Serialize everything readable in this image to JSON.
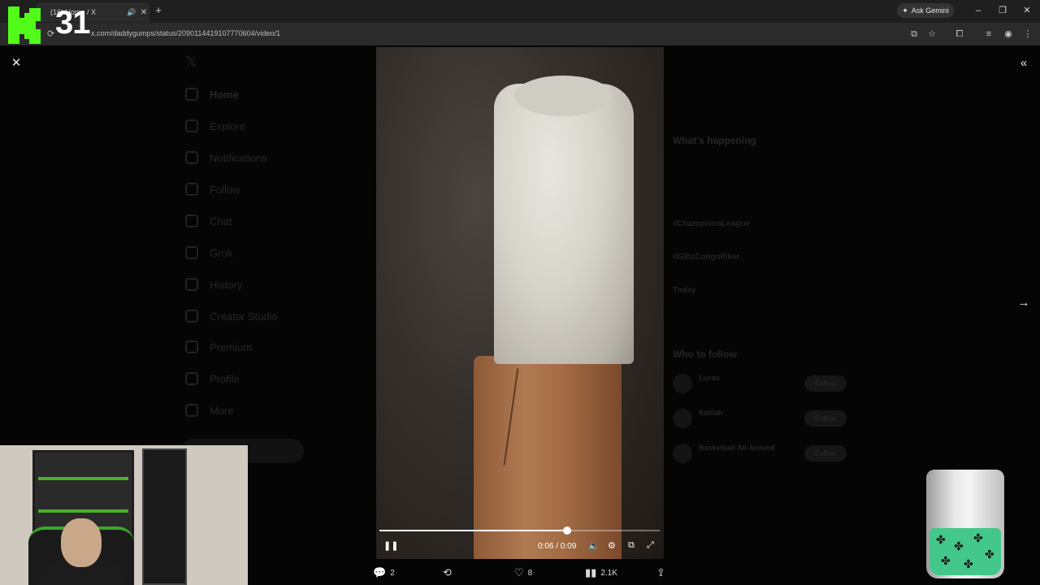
{
  "browser": {
    "tab_title": "(16) Home / X",
    "url": "x.com/daddygumps/status/2090114419107770604/video/1",
    "gemini_label": "Ask Gemini"
  },
  "overlay": {
    "counter": "31"
  },
  "sidebar": {
    "items": [
      {
        "label": "Home",
        "icon": "home-icon"
      },
      {
        "label": "Explore",
        "icon": "search-icon"
      },
      {
        "label": "Notifications",
        "icon": "bell-icon"
      },
      {
        "label": "Follow",
        "icon": "person-icon"
      },
      {
        "label": "Chat",
        "icon": "chat-icon"
      },
      {
        "label": "Grok",
        "icon": "grok-icon"
      },
      {
        "label": "History",
        "icon": "bookmark-icon"
      },
      {
        "label": "Creator Studio",
        "icon": "rocket-icon"
      },
      {
        "label": "Premium",
        "icon": "x-circle-icon"
      },
      {
        "label": "Profile",
        "icon": "profile-icon"
      },
      {
        "label": "More",
        "icon": "more-icon"
      }
    ]
  },
  "right_panel": {
    "whats_happening": "What's happening",
    "who_to_follow": "Who to follow",
    "trends": [
      "#ChampionsLeague",
      "#GlitzCongolliker",
      "Today"
    ],
    "follow": [
      {
        "name": "Lucas",
        "button": "Follow"
      },
      {
        "name": "Kalilah",
        "button": "Follow"
      },
      {
        "name": "Basketball All-Around",
        "button": "Follow"
      }
    ]
  },
  "video": {
    "time": "0:06 / 0:09",
    "progress": 0.67
  },
  "actions": {
    "replies": "2",
    "likes": "8",
    "views": "2.1K"
  }
}
